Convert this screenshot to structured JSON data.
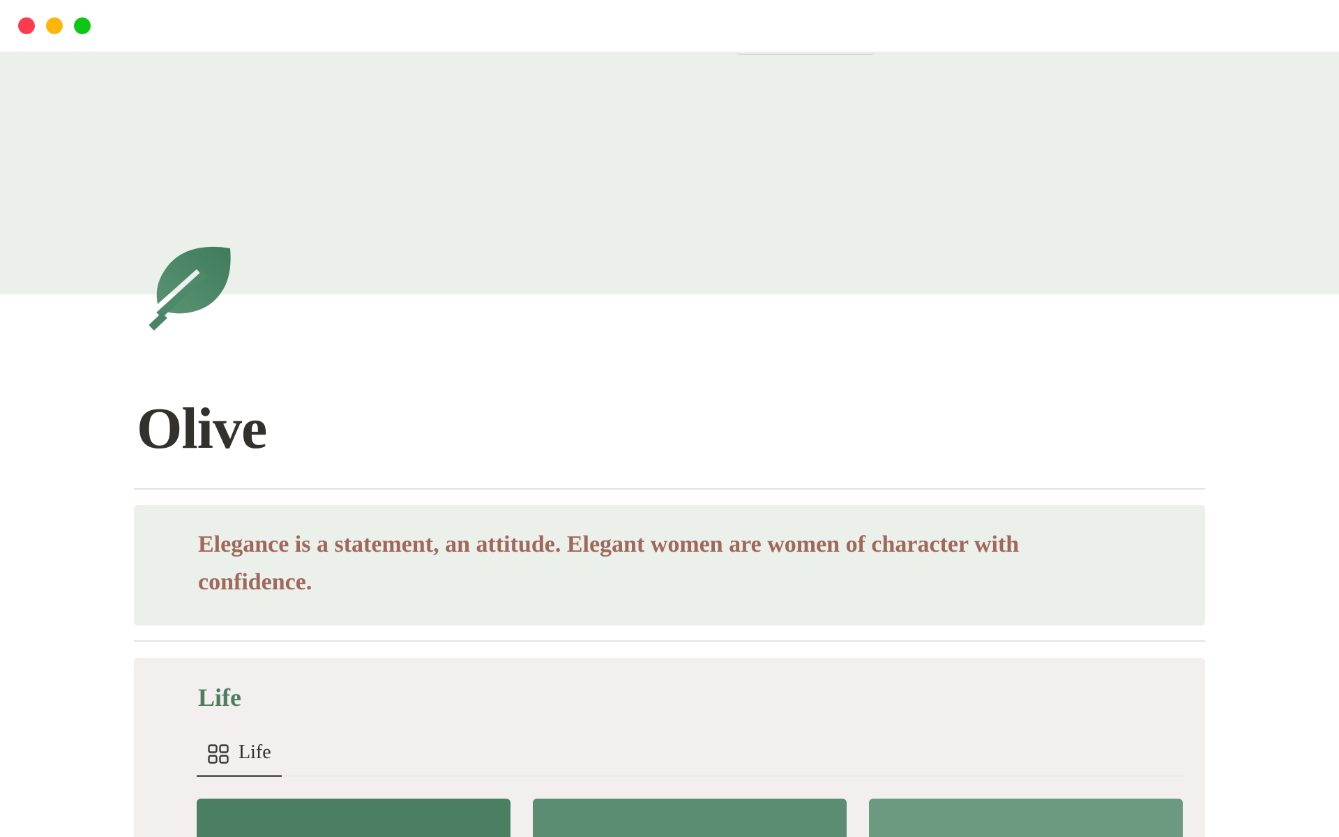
{
  "page": {
    "title": "Olive",
    "icon": "leaf-icon",
    "accent_color": "#4a8564"
  },
  "cover": {
    "color": "#ecf0ea"
  },
  "quote": {
    "text": "Elegance is a statement, an attitude. Elegant women are women of character with confidence.",
    "color": "#a0685a"
  },
  "life": {
    "heading": "Life",
    "view_tab": {
      "label": "Life",
      "icon": "gallery-view-icon"
    },
    "cards": [
      {
        "color": "#4a7f62"
      },
      {
        "color": "#5a8d71"
      },
      {
        "color": "#6c9a80"
      }
    ]
  }
}
